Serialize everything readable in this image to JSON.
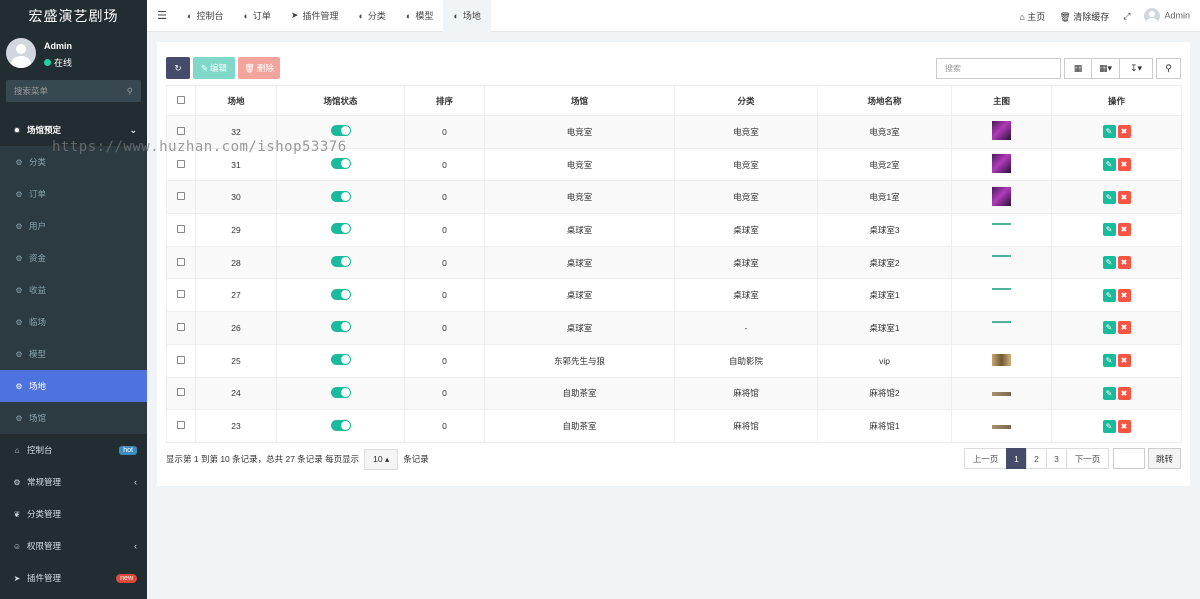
{
  "brand": "宏盛演艺剧场",
  "user": {
    "name": "Admin",
    "status": "在线"
  },
  "side_search_placeholder": "搜索菜单",
  "menu": {
    "group_title": "场馆预定",
    "subs": [
      "分类",
      "订单",
      "用户",
      "资金",
      "收益",
      "临场",
      "模型",
      "场地",
      "场馆"
    ],
    "active_sub": "场地",
    "main": [
      {
        "label": "控制台",
        "badge": "hot"
      },
      {
        "label": "常规管理",
        "arrow": "‹"
      },
      {
        "label": "分类管理"
      },
      {
        "label": "权限管理",
        "arrow": "‹"
      },
      {
        "label": "插件管理",
        "badge": "new"
      }
    ]
  },
  "topnav": {
    "tabs": [
      "控制台",
      "订单",
      "插件管理",
      "分类",
      "模型",
      "场地"
    ],
    "active_tab": "场地",
    "home": "主页",
    "clear_cache": "清除缓存",
    "admin": "Admin"
  },
  "toolbar": {
    "edit": "编辑",
    "delete": "删除",
    "search_placeholder": "搜索"
  },
  "table": {
    "columns": [
      "场地",
      "场馆状态",
      "排序",
      "场馆",
      "分类",
      "场地名称",
      "主图",
      "操作"
    ],
    "rows": [
      {
        "id": "32",
        "sort": "0",
        "venue": "电竞室",
        "category": "电竞室",
        "name": "电竞3室",
        "img": "purple"
      },
      {
        "id": "31",
        "sort": "0",
        "venue": "电竞室",
        "category": "电竞室",
        "name": "电竞2室",
        "img": "purple"
      },
      {
        "id": "30",
        "sort": "0",
        "venue": "电竞室",
        "category": "电竞室",
        "name": "电竞1室",
        "img": "purple"
      },
      {
        "id": "29",
        "sort": "0",
        "venue": "桌球室",
        "category": "桌球室",
        "name": "桌球室3",
        "img": "line"
      },
      {
        "id": "28",
        "sort": "0",
        "venue": "桌球室",
        "category": "桌球室",
        "name": "桌球室2",
        "img": "line"
      },
      {
        "id": "27",
        "sort": "0",
        "venue": "桌球室",
        "category": "桌球室",
        "name": "桌球室1",
        "img": "line"
      },
      {
        "id": "26",
        "sort": "0",
        "venue": "桌球室",
        "category": "-",
        "name": "桌球室1",
        "img": "line"
      },
      {
        "id": "25",
        "sort": "0",
        "venue": "东郭先生与狼",
        "category": "自助影院",
        "name": "vip",
        "img": "tan"
      },
      {
        "id": "24",
        "sort": "0",
        "venue": "自助茶室",
        "category": "麻将馆",
        "name": "麻将馆2",
        "img": "strip"
      },
      {
        "id": "23",
        "sort": "0",
        "venue": "自助茶室",
        "category": "麻将馆",
        "name": "麻将馆1",
        "img": "strip"
      }
    ]
  },
  "footer": {
    "summary": "显示第 1 到第 10 条记录，总共 27 条记录 每页显示",
    "page_size": "10",
    "suffix": "条记录",
    "prev": "上一页",
    "pages": [
      "1",
      "2",
      "3"
    ],
    "current_page": "1",
    "next": "下一页",
    "jump": "跳转"
  },
  "watermark": "https://www.huzhan.com/ishop53376"
}
